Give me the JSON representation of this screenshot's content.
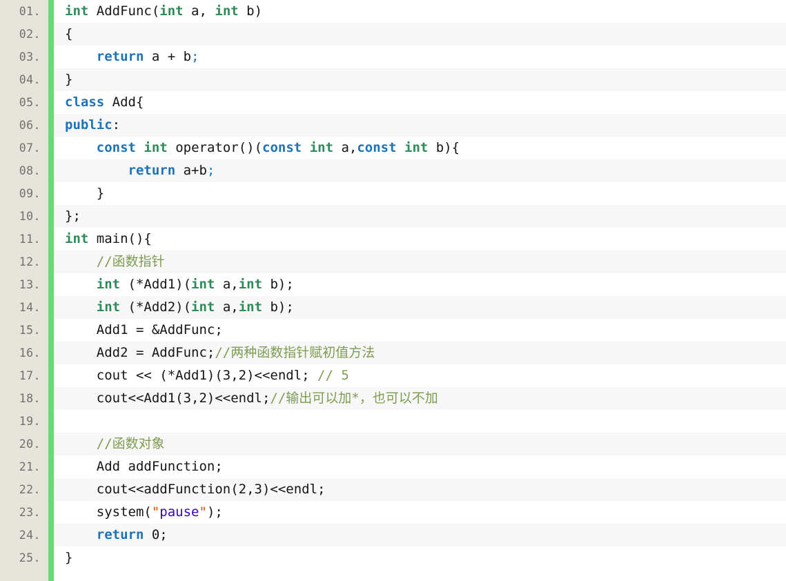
{
  "editor": {
    "language": "C++",
    "total_lines": 25,
    "line_number_suffix": ".",
    "colors": {
      "gutter_background": "#e7e5db",
      "gutter_text": "#6f6f6f",
      "change_marker": "#68db72",
      "row_odd_background": "#ffffff",
      "row_even_background": "#f7f7f7",
      "keyword": "#1e72b8",
      "type": "#2e8b57",
      "comment": "#7e9b52",
      "string": "#3300cc",
      "string_quote": "#cc5500",
      "plain_text": "#151515"
    }
  },
  "lines": [
    {
      "number": "01.",
      "text": "int AddFunc(int a, int b)",
      "tokens": [
        {
          "t": "int",
          "c": "t-type"
        },
        {
          "t": " AddFunc(",
          "c": "t-plain"
        },
        {
          "t": "int",
          "c": "t-type"
        },
        {
          "t": " a, ",
          "c": "t-plain"
        },
        {
          "t": "int",
          "c": "t-type"
        },
        {
          "t": " b)",
          "c": "t-plain"
        }
      ]
    },
    {
      "number": "02.",
      "text": "{",
      "tokens": [
        {
          "t": "{",
          "c": "t-plain"
        }
      ]
    },
    {
      "number": "03.",
      "text": "    return a + b;",
      "tokens": [
        {
          "t": "    ",
          "c": "t-plain"
        },
        {
          "t": "return",
          "c": "t-kw"
        },
        {
          "t": " a + b",
          "c": "t-plain"
        },
        {
          "t": ";",
          "c": "t-punc"
        }
      ]
    },
    {
      "number": "04.",
      "text": "}",
      "tokens": [
        {
          "t": "}",
          "c": "t-plain"
        }
      ]
    },
    {
      "number": "05.",
      "text": "class Add{",
      "tokens": [
        {
          "t": "class",
          "c": "t-kw"
        },
        {
          "t": " Add{",
          "c": "t-plain"
        }
      ]
    },
    {
      "number": "06.",
      "text": "public:",
      "tokens": [
        {
          "t": "public",
          "c": "t-kw"
        },
        {
          "t": ":",
          "c": "t-plain"
        }
      ]
    },
    {
      "number": "07.",
      "text": "    const int operator()(const int a,const int b){",
      "tokens": [
        {
          "t": "    ",
          "c": "t-plain"
        },
        {
          "t": "const",
          "c": "t-kw"
        },
        {
          "t": " ",
          "c": "t-plain"
        },
        {
          "t": "int",
          "c": "t-type"
        },
        {
          "t": " operator()(",
          "c": "t-plain"
        },
        {
          "t": "const",
          "c": "t-kw"
        },
        {
          "t": " ",
          "c": "t-plain"
        },
        {
          "t": "int",
          "c": "t-type"
        },
        {
          "t": " a,",
          "c": "t-plain"
        },
        {
          "t": "const",
          "c": "t-kw"
        },
        {
          "t": " ",
          "c": "t-plain"
        },
        {
          "t": "int",
          "c": "t-type"
        },
        {
          "t": " b){",
          "c": "t-plain"
        }
      ]
    },
    {
      "number": "08.",
      "text": "        return a+b;",
      "tokens": [
        {
          "t": "        ",
          "c": "t-plain"
        },
        {
          "t": "return",
          "c": "t-kw"
        },
        {
          "t": " a+b",
          "c": "t-plain"
        },
        {
          "t": ";",
          "c": "t-punc"
        }
      ]
    },
    {
      "number": "09.",
      "text": "    }",
      "tokens": [
        {
          "t": "    }",
          "c": "t-plain"
        }
      ]
    },
    {
      "number": "10.",
      "text": "};",
      "tokens": [
        {
          "t": "};",
          "c": "t-plain"
        }
      ]
    },
    {
      "number": "11.",
      "text": "int main(){",
      "tokens": [
        {
          "t": "int",
          "c": "t-type"
        },
        {
          "t": " main(){",
          "c": "t-plain"
        }
      ]
    },
    {
      "number": "12.",
      "text": "    //函数指针",
      "tokens": [
        {
          "t": "    ",
          "c": "t-plain"
        },
        {
          "t": "//函数指针",
          "c": "t-comment"
        }
      ]
    },
    {
      "number": "13.",
      "text": "    int (*Add1)(int a,int b);",
      "tokens": [
        {
          "t": "    ",
          "c": "t-plain"
        },
        {
          "t": "int",
          "c": "t-type"
        },
        {
          "t": " (*Add1)(",
          "c": "t-plain"
        },
        {
          "t": "int",
          "c": "t-type"
        },
        {
          "t": " a,",
          "c": "t-plain"
        },
        {
          "t": "int",
          "c": "t-type"
        },
        {
          "t": " b);",
          "c": "t-plain"
        }
      ]
    },
    {
      "number": "14.",
      "text": "    int (*Add2)(int a,int b);",
      "tokens": [
        {
          "t": "    ",
          "c": "t-plain"
        },
        {
          "t": "int",
          "c": "t-type"
        },
        {
          "t": " (*Add2)(",
          "c": "t-plain"
        },
        {
          "t": "int",
          "c": "t-type"
        },
        {
          "t": " a,",
          "c": "t-plain"
        },
        {
          "t": "int",
          "c": "t-type"
        },
        {
          "t": " b);",
          "c": "t-plain"
        }
      ]
    },
    {
      "number": "15.",
      "text": "    Add1 = &AddFunc;",
      "tokens": [
        {
          "t": "    Add1 = &AddFunc;",
          "c": "t-plain"
        }
      ]
    },
    {
      "number": "16.",
      "text": "    Add2 = AddFunc;//两种函数指针赋初值方法",
      "tokens": [
        {
          "t": "    Add2 = AddFunc;",
          "c": "t-plain"
        },
        {
          "t": "//两种函数指针赋初值方法",
          "c": "t-comment"
        }
      ]
    },
    {
      "number": "17.",
      "text": "    cout << (*Add1)(3,2)<<endl; // 5",
      "tokens": [
        {
          "t": "    cout << (*Add1)(3,2)<<endl; ",
          "c": "t-plain"
        },
        {
          "t": "// 5",
          "c": "t-comment"
        }
      ]
    },
    {
      "number": "18.",
      "text": "    cout<<Add1(3,2)<<endl;//输出可以加*，也可以不加",
      "tokens": [
        {
          "t": "    cout<<Add1(3,2)<<endl;",
          "c": "t-plain"
        },
        {
          "t": "//输出可以加*，也可以不加",
          "c": "t-comment"
        }
      ]
    },
    {
      "number": "19.",
      "text": "",
      "tokens": []
    },
    {
      "number": "20.",
      "text": "    //函数对象",
      "tokens": [
        {
          "t": "    ",
          "c": "t-plain"
        },
        {
          "t": "//函数对象",
          "c": "t-comment"
        }
      ]
    },
    {
      "number": "21.",
      "text": "    Add addFunction;",
      "tokens": [
        {
          "t": "    Add addFunction;",
          "c": "t-plain"
        }
      ]
    },
    {
      "number": "22.",
      "text": "    cout<<addFunction(2,3)<<endl;",
      "tokens": [
        {
          "t": "    cout<<addFunction(2,3)<<endl;",
          "c": "t-plain"
        }
      ]
    },
    {
      "number": "23.",
      "text": "    system(\"pause\");",
      "tokens": [
        {
          "t": "    system(",
          "c": "t-plain"
        },
        {
          "t": "\"",
          "c": "t-quote"
        },
        {
          "t": "pause",
          "c": "t-str"
        },
        {
          "t": "\"",
          "c": "t-quote"
        },
        {
          "t": ");",
          "c": "t-plain"
        }
      ]
    },
    {
      "number": "24.",
      "text": "    return 0;",
      "tokens": [
        {
          "t": "    ",
          "c": "t-plain"
        },
        {
          "t": "return",
          "c": "t-kw"
        },
        {
          "t": " 0;",
          "c": "t-plain"
        }
      ]
    },
    {
      "number": "25.",
      "text": "}",
      "tokens": [
        {
          "t": "}",
          "c": "t-plain"
        }
      ]
    }
  ]
}
